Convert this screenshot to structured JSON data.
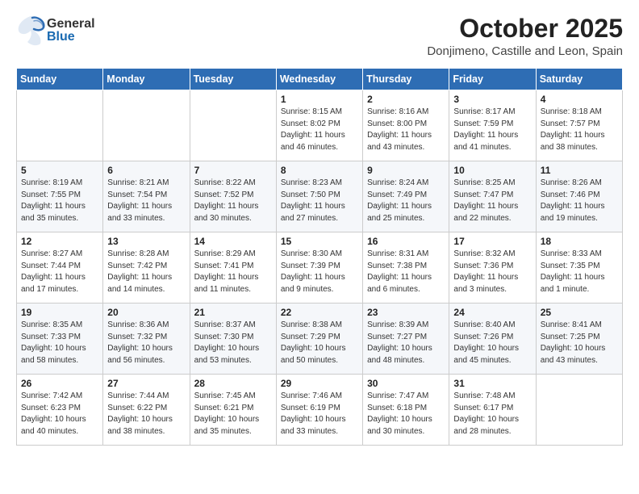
{
  "header": {
    "logo_general": "General",
    "logo_blue": "Blue",
    "title": "October 2025",
    "subtitle": "Donjimeno, Castille and Leon, Spain"
  },
  "days_of_week": [
    "Sunday",
    "Monday",
    "Tuesday",
    "Wednesday",
    "Thursday",
    "Friday",
    "Saturday"
  ],
  "weeks": [
    [
      {
        "day": "",
        "info": ""
      },
      {
        "day": "",
        "info": ""
      },
      {
        "day": "",
        "info": ""
      },
      {
        "day": "1",
        "info": "Sunrise: 8:15 AM\nSunset: 8:02 PM\nDaylight: 11 hours\nand 46 minutes."
      },
      {
        "day": "2",
        "info": "Sunrise: 8:16 AM\nSunset: 8:00 PM\nDaylight: 11 hours\nand 43 minutes."
      },
      {
        "day": "3",
        "info": "Sunrise: 8:17 AM\nSunset: 7:59 PM\nDaylight: 11 hours\nand 41 minutes."
      },
      {
        "day": "4",
        "info": "Sunrise: 8:18 AM\nSunset: 7:57 PM\nDaylight: 11 hours\nand 38 minutes."
      }
    ],
    [
      {
        "day": "5",
        "info": "Sunrise: 8:19 AM\nSunset: 7:55 PM\nDaylight: 11 hours\nand 35 minutes."
      },
      {
        "day": "6",
        "info": "Sunrise: 8:21 AM\nSunset: 7:54 PM\nDaylight: 11 hours\nand 33 minutes."
      },
      {
        "day": "7",
        "info": "Sunrise: 8:22 AM\nSunset: 7:52 PM\nDaylight: 11 hours\nand 30 minutes."
      },
      {
        "day": "8",
        "info": "Sunrise: 8:23 AM\nSunset: 7:50 PM\nDaylight: 11 hours\nand 27 minutes."
      },
      {
        "day": "9",
        "info": "Sunrise: 8:24 AM\nSunset: 7:49 PM\nDaylight: 11 hours\nand 25 minutes."
      },
      {
        "day": "10",
        "info": "Sunrise: 8:25 AM\nSunset: 7:47 PM\nDaylight: 11 hours\nand 22 minutes."
      },
      {
        "day": "11",
        "info": "Sunrise: 8:26 AM\nSunset: 7:46 PM\nDaylight: 11 hours\nand 19 minutes."
      }
    ],
    [
      {
        "day": "12",
        "info": "Sunrise: 8:27 AM\nSunset: 7:44 PM\nDaylight: 11 hours\nand 17 minutes."
      },
      {
        "day": "13",
        "info": "Sunrise: 8:28 AM\nSunset: 7:42 PM\nDaylight: 11 hours\nand 14 minutes."
      },
      {
        "day": "14",
        "info": "Sunrise: 8:29 AM\nSunset: 7:41 PM\nDaylight: 11 hours\nand 11 minutes."
      },
      {
        "day": "15",
        "info": "Sunrise: 8:30 AM\nSunset: 7:39 PM\nDaylight: 11 hours\nand 9 minutes."
      },
      {
        "day": "16",
        "info": "Sunrise: 8:31 AM\nSunset: 7:38 PM\nDaylight: 11 hours\nand 6 minutes."
      },
      {
        "day": "17",
        "info": "Sunrise: 8:32 AM\nSunset: 7:36 PM\nDaylight: 11 hours\nand 3 minutes."
      },
      {
        "day": "18",
        "info": "Sunrise: 8:33 AM\nSunset: 7:35 PM\nDaylight: 11 hours\nand 1 minute."
      }
    ],
    [
      {
        "day": "19",
        "info": "Sunrise: 8:35 AM\nSunset: 7:33 PM\nDaylight: 10 hours\nand 58 minutes."
      },
      {
        "day": "20",
        "info": "Sunrise: 8:36 AM\nSunset: 7:32 PM\nDaylight: 10 hours\nand 56 minutes."
      },
      {
        "day": "21",
        "info": "Sunrise: 8:37 AM\nSunset: 7:30 PM\nDaylight: 10 hours\nand 53 minutes."
      },
      {
        "day": "22",
        "info": "Sunrise: 8:38 AM\nSunset: 7:29 PM\nDaylight: 10 hours\nand 50 minutes."
      },
      {
        "day": "23",
        "info": "Sunrise: 8:39 AM\nSunset: 7:27 PM\nDaylight: 10 hours\nand 48 minutes."
      },
      {
        "day": "24",
        "info": "Sunrise: 8:40 AM\nSunset: 7:26 PM\nDaylight: 10 hours\nand 45 minutes."
      },
      {
        "day": "25",
        "info": "Sunrise: 8:41 AM\nSunset: 7:25 PM\nDaylight: 10 hours\nand 43 minutes."
      }
    ],
    [
      {
        "day": "26",
        "info": "Sunrise: 7:42 AM\nSunset: 6:23 PM\nDaylight: 10 hours\nand 40 minutes."
      },
      {
        "day": "27",
        "info": "Sunrise: 7:44 AM\nSunset: 6:22 PM\nDaylight: 10 hours\nand 38 minutes."
      },
      {
        "day": "28",
        "info": "Sunrise: 7:45 AM\nSunset: 6:21 PM\nDaylight: 10 hours\nand 35 minutes."
      },
      {
        "day": "29",
        "info": "Sunrise: 7:46 AM\nSunset: 6:19 PM\nDaylight: 10 hours\nand 33 minutes."
      },
      {
        "day": "30",
        "info": "Sunrise: 7:47 AM\nSunset: 6:18 PM\nDaylight: 10 hours\nand 30 minutes."
      },
      {
        "day": "31",
        "info": "Sunrise: 7:48 AM\nSunset: 6:17 PM\nDaylight: 10 hours\nand 28 minutes."
      },
      {
        "day": "",
        "info": ""
      }
    ]
  ]
}
